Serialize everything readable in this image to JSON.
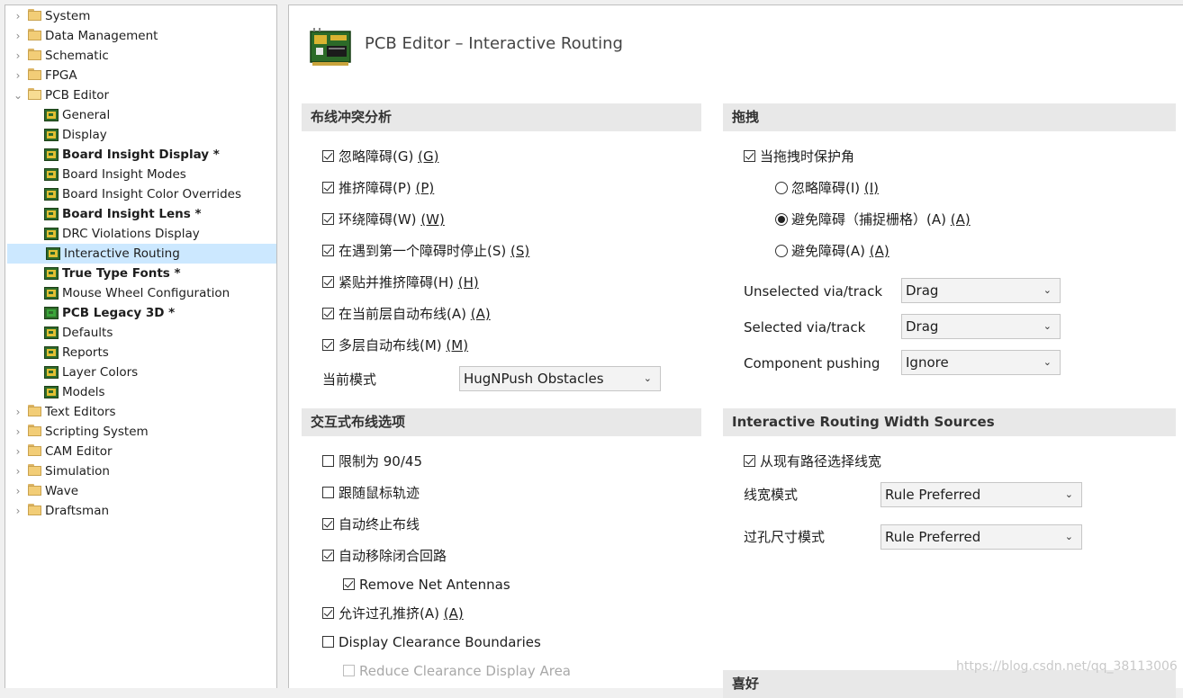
{
  "tree": [
    {
      "label": "System",
      "type": "folder",
      "expanded": false,
      "bold": false
    },
    {
      "label": "Data Management",
      "type": "folder",
      "expanded": false,
      "bold": false
    },
    {
      "label": "Schematic",
      "type": "folder",
      "expanded": false,
      "bold": false
    },
    {
      "label": "FPGA",
      "type": "folder",
      "expanded": false,
      "bold": false
    },
    {
      "label": "PCB Editor",
      "type": "folder",
      "expanded": true,
      "bold": false
    },
    {
      "label": "General",
      "type": "page",
      "bold": false
    },
    {
      "label": "Display",
      "type": "page",
      "bold": false
    },
    {
      "label": "Board Insight Display *",
      "type": "page",
      "bold": true
    },
    {
      "label": "Board Insight Modes",
      "type": "page",
      "bold": false
    },
    {
      "label": "Board Insight Color Overrides",
      "type": "page",
      "bold": false
    },
    {
      "label": "Board Insight Lens *",
      "type": "page",
      "bold": true
    },
    {
      "label": "DRC Violations Display",
      "type": "page",
      "bold": false
    },
    {
      "label": "Interactive Routing",
      "type": "page",
      "bold": false,
      "selected": true
    },
    {
      "label": "True Type Fonts *",
      "type": "page",
      "bold": true
    },
    {
      "label": "Mouse Wheel Configuration",
      "type": "page",
      "bold": false
    },
    {
      "label": "PCB Legacy 3D *",
      "type": "page3d",
      "bold": true
    },
    {
      "label": "Defaults",
      "type": "page",
      "bold": false
    },
    {
      "label": "Reports",
      "type": "page",
      "bold": false
    },
    {
      "label": "Layer Colors",
      "type": "page",
      "bold": false
    },
    {
      "label": "Models",
      "type": "page",
      "bold": false
    },
    {
      "label": "Text Editors",
      "type": "folder",
      "expanded": false,
      "bold": false
    },
    {
      "label": "Scripting System",
      "type": "folder",
      "expanded": false,
      "bold": false
    },
    {
      "label": "CAM Editor",
      "type": "folder",
      "expanded": false,
      "bold": false
    },
    {
      "label": "Simulation",
      "type": "folder",
      "expanded": false,
      "bold": false
    },
    {
      "label": "Wave",
      "type": "folder",
      "expanded": false,
      "bold": false
    },
    {
      "label": "Draftsman",
      "type": "folder",
      "expanded": false,
      "bold": false
    }
  ],
  "page_title": "PCB Editor – Interactive Routing",
  "conflict": {
    "heading": "布线冲突分析",
    "options": [
      {
        "text": "忽略障碍(G) ",
        "key": "(G)",
        "checked": true
      },
      {
        "text": "推挤障碍(P) ",
        "key": "(P)",
        "checked": true
      },
      {
        "text": "环绕障碍(W) ",
        "key": "(W)",
        "checked": true
      },
      {
        "text": "在遇到第一个障碍时停止(S) ",
        "key": "(S)",
        "checked": true
      },
      {
        "text": "紧贴并推挤障碍(H) ",
        "key": "(H)",
        "checked": true
      },
      {
        "text": "在当前层自动布线(A) ",
        "key": "(A)",
        "checked": true
      },
      {
        "text": "多层自动布线(M) ",
        "key": "(M)",
        "checked": true
      }
    ],
    "mode_label": "当前模式",
    "mode_value": "HugNPush Obstacles"
  },
  "interactive": {
    "heading": "交互式布线选项",
    "options": [
      {
        "text": "限制为 90/45",
        "checked": false,
        "indent": false,
        "disabled": false
      },
      {
        "text": "跟随鼠标轨迹",
        "checked": false,
        "indent": false,
        "disabled": false
      },
      {
        "text": "自动终止布线",
        "checked": true,
        "indent": false,
        "disabled": false
      },
      {
        "text": "自动移除闭合回路",
        "checked": true,
        "indent": false,
        "disabled": false
      },
      {
        "text": "Remove Net Antennas",
        "checked": true,
        "indent": true,
        "disabled": false
      },
      {
        "text": "允许过孔推挤(A) ",
        "key": "(A)",
        "checked": true,
        "indent": false,
        "disabled": false
      },
      {
        "text": "Display Clearance Boundaries",
        "checked": false,
        "indent": false,
        "disabled": false
      },
      {
        "text": "Reduce Clearance Display Area",
        "checked": false,
        "indent": true,
        "disabled": true
      }
    ]
  },
  "drag": {
    "heading": "拖拽",
    "protect_label": "当拖拽时保护角",
    "protect_checked": true,
    "radios": [
      {
        "text": "忽略障碍(I) ",
        "key": "(I)",
        "selected": false
      },
      {
        "text": "避免障碍（捕捉栅格）(A) ",
        "key": "(A)",
        "selected": true
      },
      {
        "text": "避免障碍(A) ",
        "key": "(A)",
        "selected": false
      }
    ],
    "fields": [
      {
        "label": "Unselected via/track",
        "value": "Drag"
      },
      {
        "label": "Selected via/track",
        "value": "Drag"
      },
      {
        "label": "Component pushing",
        "value": "Ignore"
      }
    ]
  },
  "width": {
    "heading": "Interactive Routing Width Sources",
    "pick_label": "从现有路径选择线宽",
    "pick_checked": true,
    "fields": [
      {
        "label": "线宽模式",
        "value": "Rule Preferred"
      },
      {
        "label": "过孔尺寸模式",
        "value": "Rule Preferred"
      }
    ]
  },
  "next_heading": "喜好",
  "watermark": "https://blog.csdn.net/qq_38113006"
}
